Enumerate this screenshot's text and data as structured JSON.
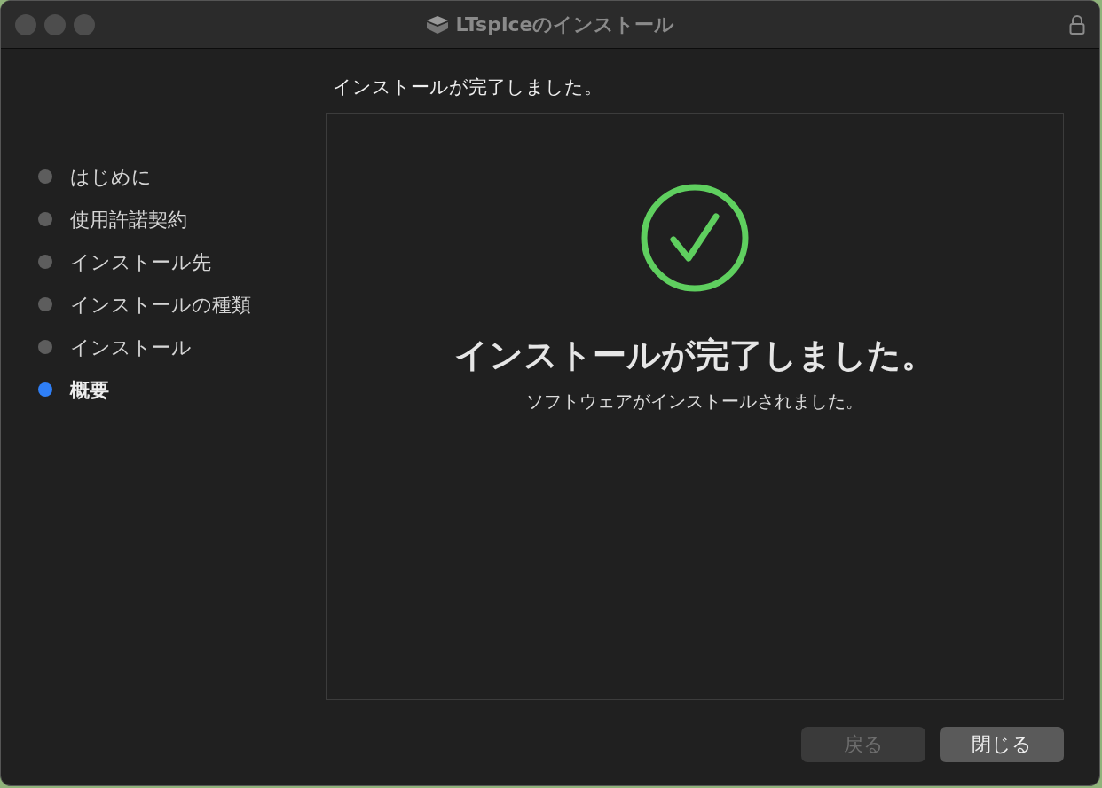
{
  "window": {
    "title": "LTspiceのインストール"
  },
  "steps": [
    {
      "label": "はじめに",
      "selected": false
    },
    {
      "label": "使用許諾契約",
      "selected": false
    },
    {
      "label": "インストール先",
      "selected": false
    },
    {
      "label": "インストールの種類",
      "selected": false
    },
    {
      "label": "インストール",
      "selected": false
    },
    {
      "label": "概要",
      "selected": true
    }
  ],
  "header": "インストールが完了しました。",
  "panel": {
    "heading": "インストールが完了しました。",
    "message": "ソフトウェアがインストールされました。"
  },
  "buttons": [
    {
      "label": "戻る",
      "disabled": true
    },
    {
      "label": "閉じる",
      "disabled": false
    }
  ]
}
